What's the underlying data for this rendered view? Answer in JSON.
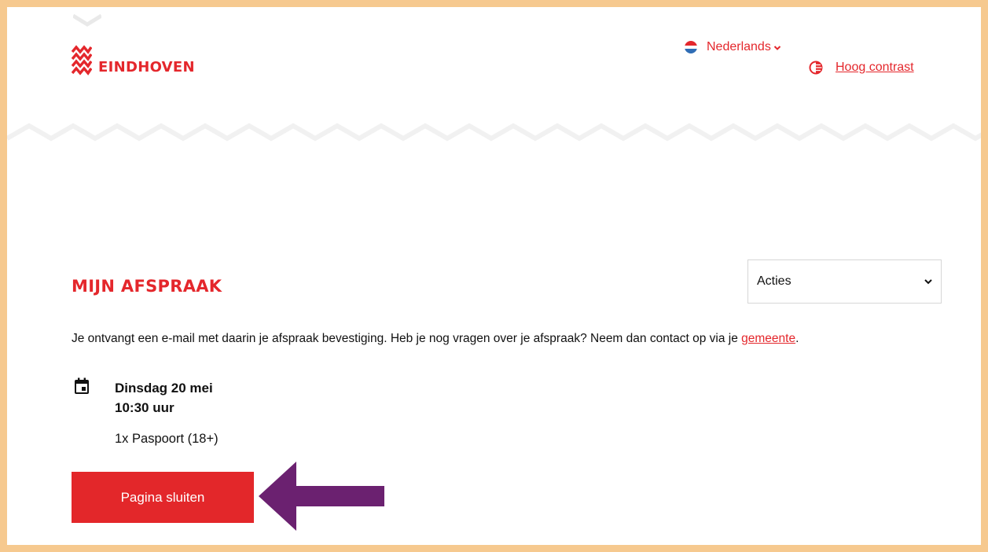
{
  "header": {
    "logo_text": "EINDHOVEN",
    "language": {
      "label": "Nederlands",
      "flag_icon": "netherlands-flag-icon"
    },
    "contrast": {
      "label": "Hoog contrast",
      "icon": "contrast-icon"
    }
  },
  "main": {
    "title": "MIJN AFSPRAAK",
    "actions_select": {
      "value": "Acties"
    },
    "info_text": "Je ontvangt een e-mail met daarin je afspraak bevestiging. Heb je nog vragen over je afspraak? Neem dan contact op via je ",
    "info_link": "gemeente",
    "info_end": ".",
    "appointment": {
      "date": "Dinsdag 20 mei",
      "time": "10:30 uur",
      "service": "1x Paspoort (18+)"
    },
    "close_button": "Pagina sluiten"
  },
  "colors": {
    "brand_red": "#e4272c",
    "frame": "#f6c98f",
    "annotation_arrow": "#6b2170"
  }
}
